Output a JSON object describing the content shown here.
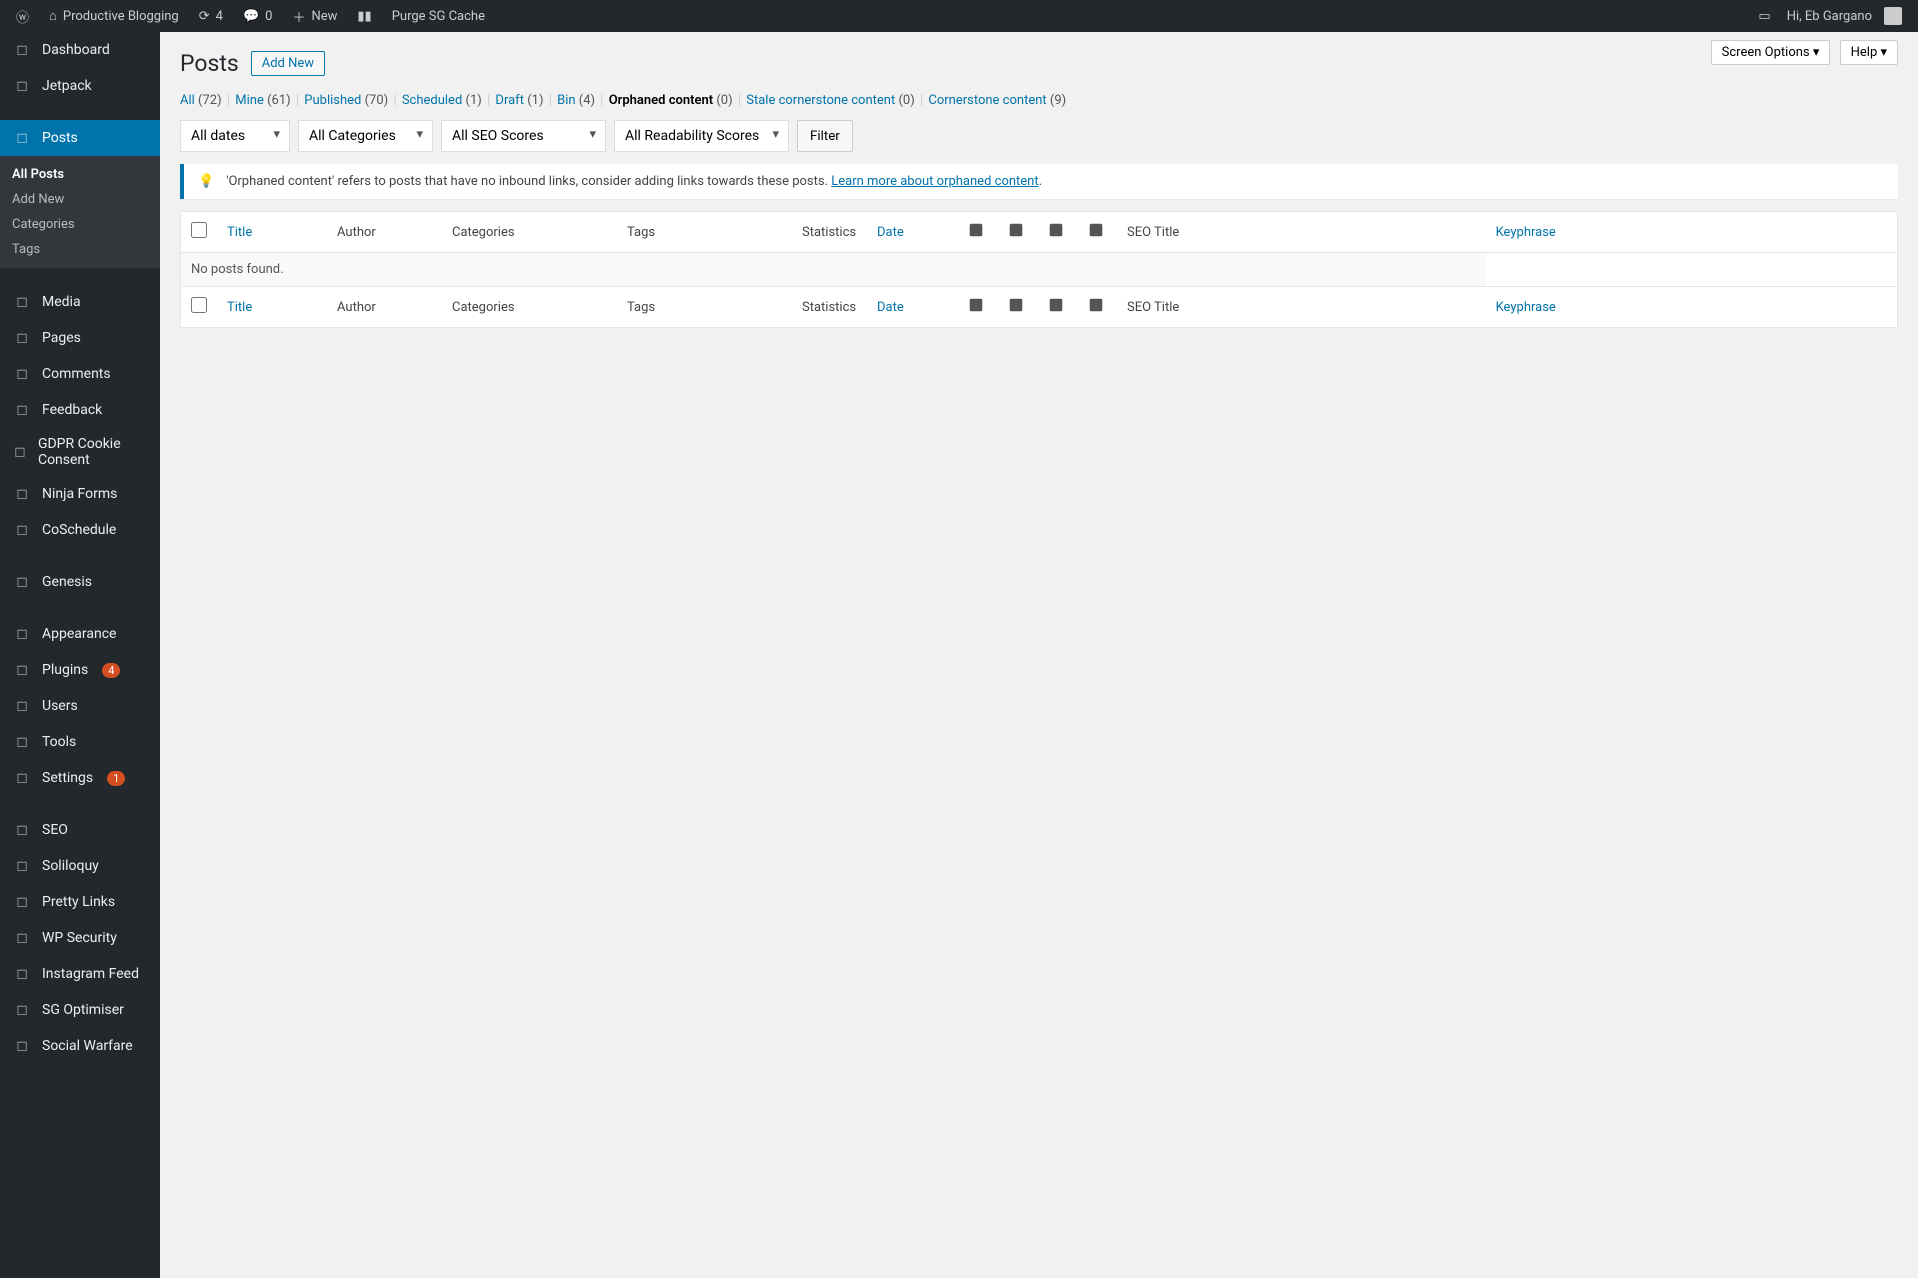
{
  "adminbar": {
    "site_name": "Productive Blogging",
    "updates_count": "4",
    "comments_count": "0",
    "new_label": "New",
    "purge_label": "Purge SG Cache",
    "greeting": "Hi, Eb Gargano"
  },
  "sidebar": {
    "items": [
      {
        "label": "Dashboard",
        "icon": "dashboard"
      },
      {
        "label": "Jetpack",
        "icon": "jetpack"
      },
      {
        "label": "Posts",
        "icon": "pin",
        "current": true
      },
      {
        "label": "Media",
        "icon": "media"
      },
      {
        "label": "Pages",
        "icon": "pages"
      },
      {
        "label": "Comments",
        "icon": "comment"
      },
      {
        "label": "Feedback",
        "icon": "feedback"
      },
      {
        "label": "GDPR Cookie Consent",
        "icon": "lock"
      },
      {
        "label": "Ninja Forms",
        "icon": "form"
      },
      {
        "label": "CoSchedule",
        "icon": "cal"
      },
      {
        "label": "Genesis",
        "icon": "genesis"
      },
      {
        "label": "Appearance",
        "icon": "brush"
      },
      {
        "label": "Plugins",
        "icon": "plug",
        "badge": "4"
      },
      {
        "label": "Users",
        "icon": "user"
      },
      {
        "label": "Tools",
        "icon": "wrench"
      },
      {
        "label": "Settings",
        "icon": "gear",
        "badge": "1"
      },
      {
        "label": "SEO",
        "icon": "seo"
      },
      {
        "label": "Soliloquy",
        "icon": "soliloquy"
      },
      {
        "label": "Pretty Links",
        "icon": "star"
      },
      {
        "label": "WP Security",
        "icon": "shield"
      },
      {
        "label": "Instagram Feed",
        "icon": "ig"
      },
      {
        "label": "SG Optimiser",
        "icon": "sg"
      },
      {
        "label": "Social Warfare",
        "icon": "sw"
      }
    ],
    "submenu": [
      {
        "label": "All Posts",
        "active": true
      },
      {
        "label": "Add New"
      },
      {
        "label": "Categories"
      },
      {
        "label": "Tags"
      }
    ]
  },
  "topbuttons": {
    "screen_options": "Screen Options",
    "help": "Help"
  },
  "page": {
    "title": "Posts",
    "add_new": "Add New"
  },
  "views": [
    {
      "label": "All",
      "count": "(72)"
    },
    {
      "label": "Mine",
      "count": "(61)"
    },
    {
      "label": "Published",
      "count": "(70)"
    },
    {
      "label": "Scheduled",
      "count": "(1)"
    },
    {
      "label": "Draft",
      "count": "(1)"
    },
    {
      "label": "Bin",
      "count": "(4)"
    },
    {
      "label": "Orphaned content",
      "count": "(0)",
      "current": true
    },
    {
      "label": "Stale cornerstone content",
      "count": "(0)"
    },
    {
      "label": "Cornerstone content",
      "count": "(9)"
    }
  ],
  "filters": {
    "dates": "All dates",
    "categories": "All Categories",
    "seo": "All SEO Scores",
    "readability": "All Readability Scores",
    "button": "Filter"
  },
  "notice": {
    "text": "'Orphaned content' refers to posts that have no inbound links, consider adding links towards these posts. ",
    "link": "Learn more about orphaned content"
  },
  "columns": {
    "title": "Title",
    "author": "Author",
    "categories": "Categories",
    "tags": "Tags",
    "stats": "Statistics",
    "date": "Date",
    "seotitle": "SEO Title",
    "keyphrase": "Keyphrase"
  },
  "empty": "No posts found."
}
